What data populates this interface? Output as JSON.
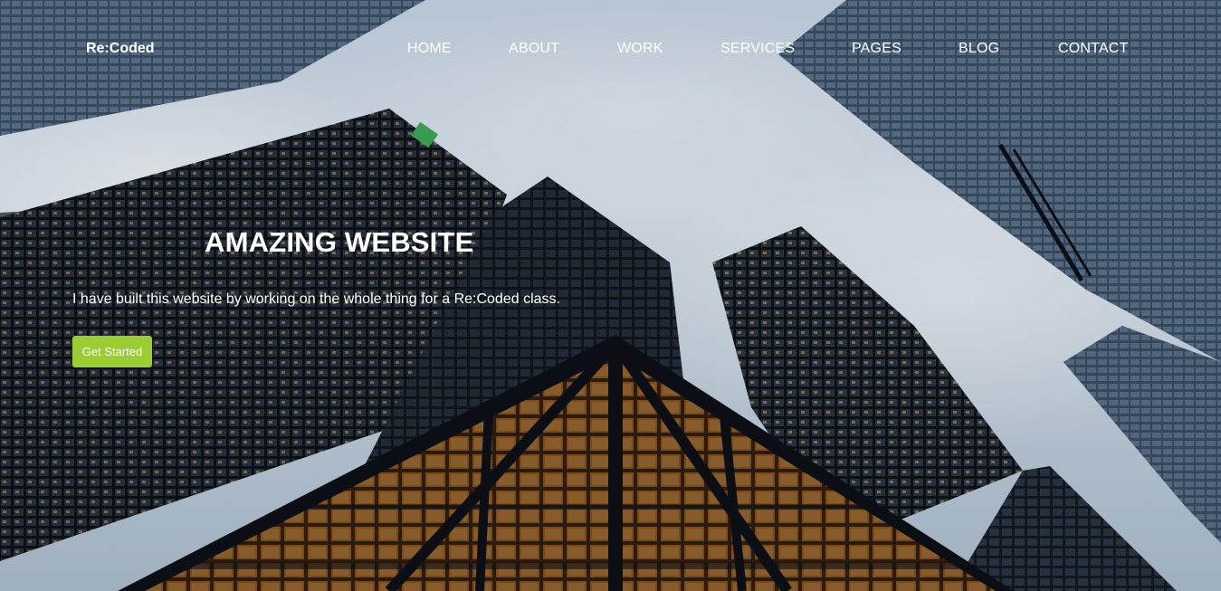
{
  "brand": {
    "logo_text": "Re:Coded"
  },
  "nav": {
    "items": [
      {
        "label": "HOME"
      },
      {
        "label": "ABOUT"
      },
      {
        "label": "WORK"
      },
      {
        "label": "SERVICES"
      },
      {
        "label": "PAGES"
      },
      {
        "label": "BLOG"
      },
      {
        "label": "CONTACT"
      }
    ]
  },
  "hero": {
    "title": "AMAZING WEBSITE",
    "text": "I have built this website by working on the whole thing for a Re:Coded class.",
    "cta_label": "Get Started"
  },
  "colors": {
    "accent": "#9acd32",
    "text": "#ffffff"
  }
}
